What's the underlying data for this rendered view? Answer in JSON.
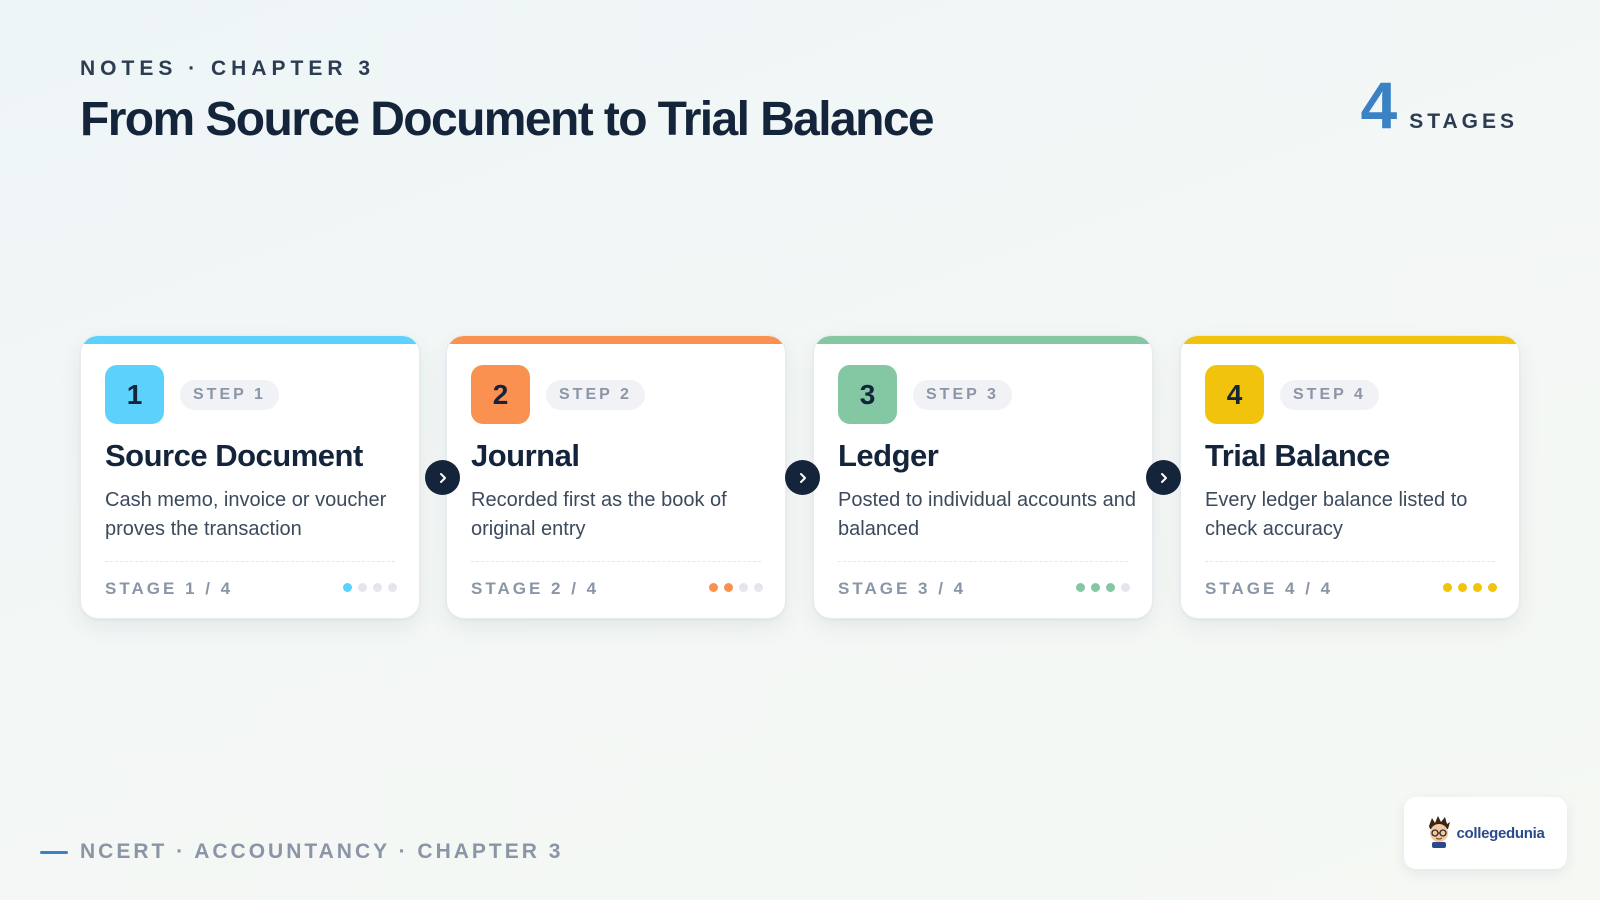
{
  "header": {
    "eyebrow": "NOTES · CHAPTER 3",
    "title": "From Source Document to Trial Balance",
    "stage_count": "4",
    "stage_count_label": "STAGES"
  },
  "colors": {
    "accent": "#3b82c4",
    "dark": "#14243a",
    "step_1": "#5bd1fb",
    "step_2": "#fb9150",
    "step_3": "#84c7a3",
    "step_4": "#f1c30d"
  },
  "steps": [
    {
      "number": "1",
      "pill": "STEP 1",
      "title": "Source Document",
      "description": "Cash memo, invoice or voucher proves the transaction",
      "stage": "STAGE 1 / 4",
      "progress": 1,
      "total": 4,
      "color": "#5bd1fb"
    },
    {
      "number": "2",
      "pill": "STEP 2",
      "title": "Journal",
      "description": "Recorded first as the book of original entry",
      "stage": "STAGE 2 / 4",
      "progress": 2,
      "total": 4,
      "color": "#fb9150"
    },
    {
      "number": "3",
      "pill": "STEP 3",
      "title": "Ledger",
      "description": "Posted to individual accounts and balanced",
      "stage": "STAGE 3 / 4",
      "progress": 3,
      "total": 4,
      "color": "#84c7a3"
    },
    {
      "number": "4",
      "pill": "STEP 4",
      "title": "Trial Balance",
      "description": "Every ledger balance listed to check accuracy",
      "stage": "STAGE 4 / 4",
      "progress": 4,
      "total": 4,
      "color": "#f1c30d"
    }
  ],
  "arrows": {
    "icon": "chevron-right-icon"
  },
  "footer": {
    "text": "NCERT · ACCOUNTANCY · CHAPTER 3"
  },
  "logo": {
    "text": "collegedunia",
    "icon": "mascot-icon"
  }
}
